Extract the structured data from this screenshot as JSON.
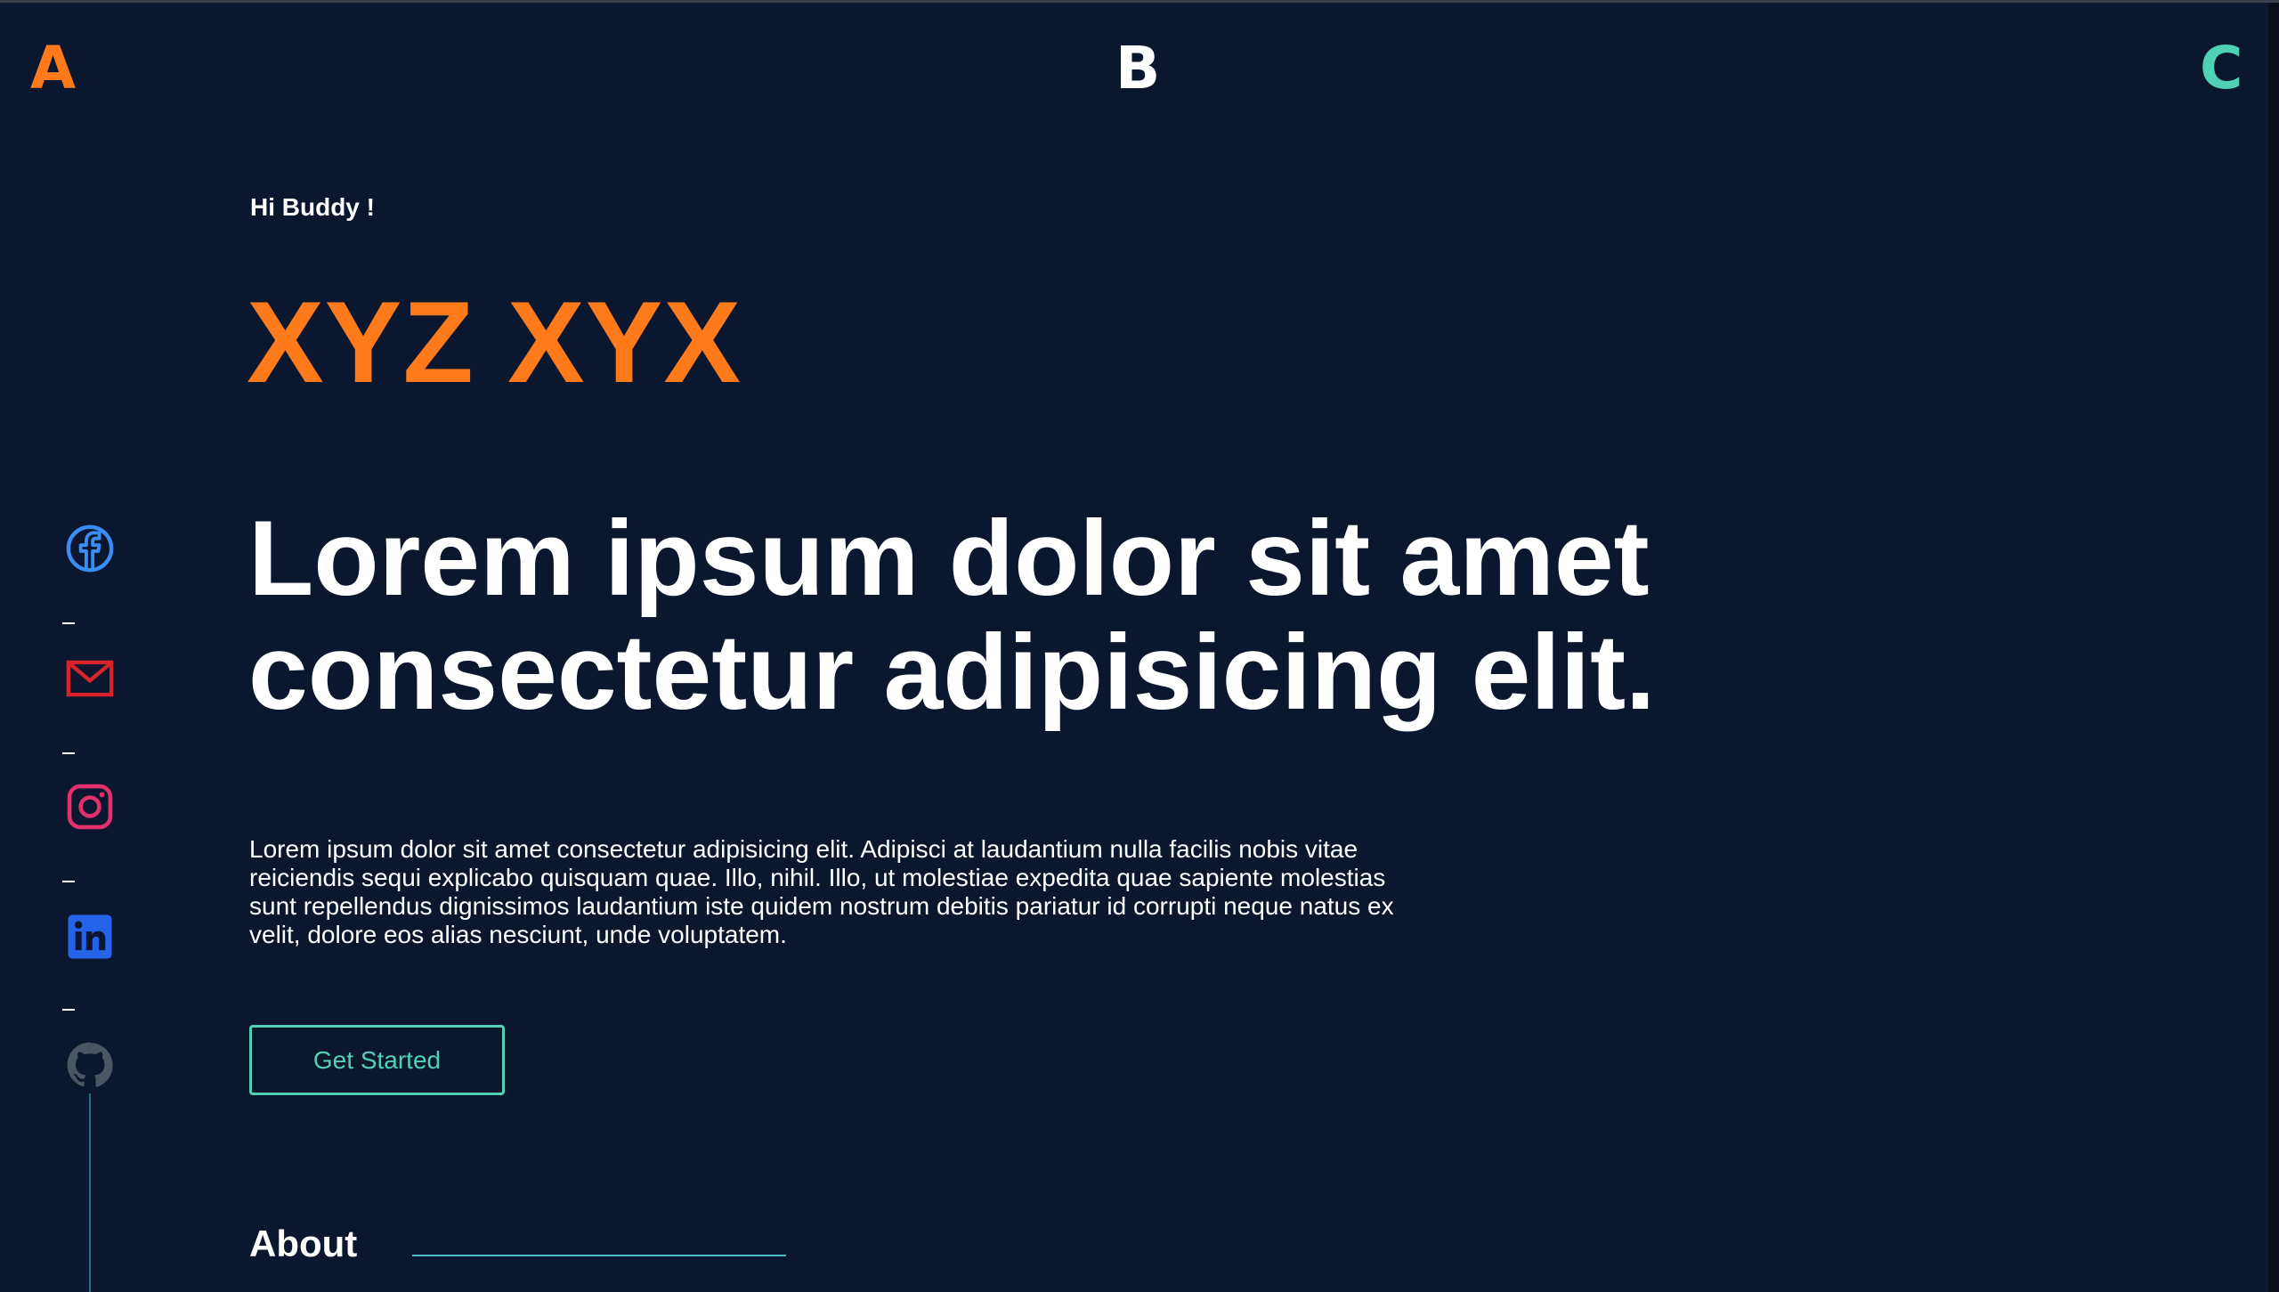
{
  "nav": {
    "left_logo": "A",
    "center_logo": "B",
    "right_logo": "C"
  },
  "social": {
    "items": [
      {
        "icon": "facebook-icon",
        "color": "#3b8cf5"
      },
      {
        "icon": "mail-icon",
        "color": "#d9222a"
      },
      {
        "icon": "instagram-icon",
        "color": "#e1306c"
      },
      {
        "icon": "linkedin-icon",
        "color": "#2563eb"
      },
      {
        "icon": "github-icon",
        "color": "#4b5563"
      }
    ]
  },
  "hero": {
    "greeting": "Hi Buddy !",
    "name": "XYZ XYX",
    "headline_line1": "Lorem ipsum dolor sit amet",
    "headline_line2": "consectetur adipisicing elit.",
    "body_line1": "Lorem ipsum dolor sit amet consectetur adipisicing elit. Adipisci at laudantium nulla facilis nobis vitae",
    "body_line2": "reiciendis sequi explicabo quisquam quae. Illo, nihil. Illo, ut molestiae expedita quae sapiente molestias",
    "body_line3": "sunt repellendus dignissimos laudantium iste quidem nostrum debitis pariatur id corrupti neque natus ex",
    "body_line4": "velit, dolore eos alias nesciunt, unde voluptatem.",
    "cta_label": "Get Started"
  },
  "about": {
    "title": "About"
  },
  "colors": {
    "background": "#0b172f",
    "accent_orange": "#ff7a1a",
    "accent_teal": "#4fd1b5",
    "text": "#ffffff"
  }
}
